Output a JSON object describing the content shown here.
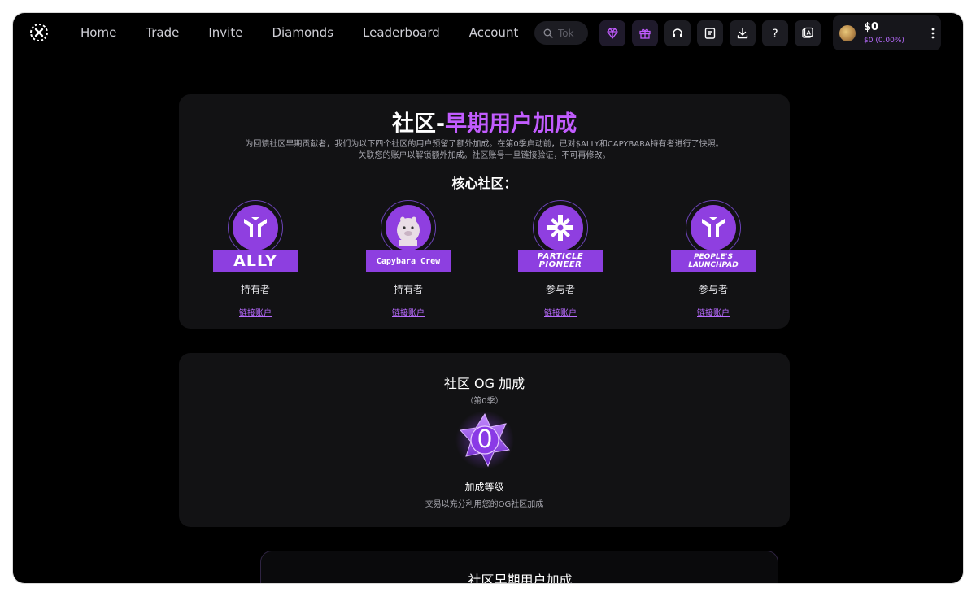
{
  "nav": {
    "items": [
      {
        "label": "Home"
      },
      {
        "label": "Trade"
      },
      {
        "label": "Invite"
      },
      {
        "label": "Diamonds"
      },
      {
        "label": "Leaderboard"
      },
      {
        "label": "Account"
      }
    ]
  },
  "search": {
    "placeholder": "Tok"
  },
  "toolbar_icons": [
    "diamond-icon",
    "gift-icon",
    "headset-icon",
    "notes-icon",
    "download-icon",
    "help-icon",
    "translate-icon"
  ],
  "wallet": {
    "balance": "$0",
    "change": "$0 (0.00%)"
  },
  "early": {
    "title_white": "社区-",
    "title_purple": "早期用户加成",
    "desc_line1": "为回馈社区早期贡献者，我们为以下四个社区的用户预留了额外加成。在第0季启动前，已对$ALLY和CAPYBARA持有者进行了快照。",
    "desc_line2": "关联您的账户以解锁额外加成。社区账号一旦链接验证，不可再修改。",
    "core_title": "核心社区：",
    "communities": [
      {
        "banner": "ALLY",
        "role": "持有者",
        "link": "链接账户"
      },
      {
        "banner": "Capybara Crew",
        "role": "持有者",
        "link": "链接账户"
      },
      {
        "banner": "PARTICLE PIONEER",
        "role": "参与者",
        "link": "链接账户"
      },
      {
        "banner": "PEOPLE'S LAUNCHPAD",
        "role": "参与者",
        "link": "链接账户"
      }
    ]
  },
  "og": {
    "title": "社区 OG 加成",
    "season": "（第0季）",
    "level_value": "0",
    "level_label": "加成等级",
    "desc": "交易以充分利用您的OG社区加成"
  },
  "bottom": {
    "title": "社区早期用户加成"
  },
  "colors": {
    "accent": "#c25cff",
    "banner": "#8d3fe0",
    "card": "#121214"
  }
}
